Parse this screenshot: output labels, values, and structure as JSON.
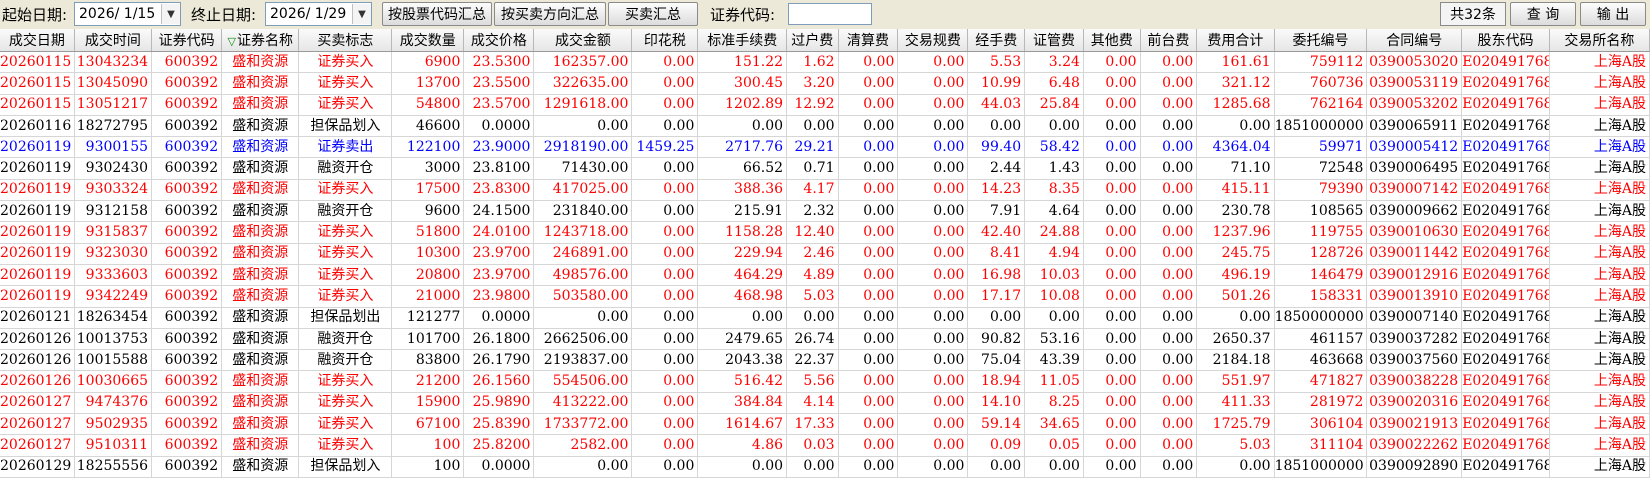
{
  "toolbar": {
    "start_label": "起始日期:",
    "start_date": "2026/ 1/15",
    "end_label": "终止日期:",
    "end_date": "2026/ 1/29",
    "btn_by_code": "按股票代码汇总",
    "btn_by_direction": "按买卖方向汇总",
    "btn_summary": "买卖汇总",
    "code_label": "证券代码:",
    "code_value": "",
    "count": "共32条",
    "query": "查 询",
    "export": "输 出"
  },
  "icons": {
    "date_dropdown": "chevron-down-icon",
    "sort": "sort-down-triangle-icon"
  },
  "colors": {
    "buy": "#ff0000",
    "sell": "#0000ff",
    "other": "#000000"
  },
  "table": {
    "headers": [
      "成交日期",
      "成交时间",
      "证券代码",
      "证券名称",
      "买卖标志",
      "成交数量",
      "成交价格",
      "成交金额",
      "印花税",
      "标准手续费",
      "过户费",
      "清算费",
      "交易规费",
      "经手费",
      "证管费",
      "其他费",
      "前台费",
      "费用合计",
      "委托编号",
      "合同编号",
      "股东代码",
      "交易所名称"
    ],
    "rows": [
      {
        "type": "buy",
        "cells": [
          "20260115",
          "13043234",
          "600392",
          "盛和资源",
          "证券买入",
          "6900",
          "23.5300",
          "162357.00",
          "0.00",
          "151.22",
          "1.62",
          "0.00",
          "0.00",
          "5.53",
          "3.24",
          "0.00",
          "0.00",
          "161.61",
          "759112",
          "0390053020",
          "E020491768",
          "上海A股"
        ]
      },
      {
        "type": "buy",
        "cells": [
          "20260115",
          "13045090",
          "600392",
          "盛和资源",
          "证券买入",
          "13700",
          "23.5500",
          "322635.00",
          "0.00",
          "300.45",
          "3.20",
          "0.00",
          "0.00",
          "10.99",
          "6.48",
          "0.00",
          "0.00",
          "321.12",
          "760736",
          "0390053119",
          "E020491768",
          "上海A股"
        ]
      },
      {
        "type": "buy",
        "cells": [
          "20260115",
          "13051217",
          "600392",
          "盛和资源",
          "证券买入",
          "54800",
          "23.5700",
          "1291618.00",
          "0.00",
          "1202.89",
          "12.92",
          "0.00",
          "0.00",
          "44.03",
          "25.84",
          "0.00",
          "0.00",
          "1285.68",
          "762164",
          "0390053202",
          "E020491768",
          "上海A股"
        ]
      },
      {
        "type": "other",
        "cells": [
          "20260116",
          "18272795",
          "600392",
          "盛和资源",
          "担保品划入",
          "46600",
          "0.0000",
          "0.00",
          "0.00",
          "0.00",
          "0.00",
          "0.00",
          "0.00",
          "0.00",
          "0.00",
          "0.00",
          "0.00",
          "0.00",
          "1851000000",
          "0390065911",
          "E020491768",
          "上海A股"
        ]
      },
      {
        "type": "sell",
        "cells": [
          "20260119",
          "9300155",
          "600392",
          "盛和资源",
          "证券卖出",
          "122100",
          "23.9000",
          "2918190.00",
          "1459.25",
          "2717.76",
          "29.21",
          "0.00",
          "0.00",
          "99.40",
          "58.42",
          "0.00",
          "0.00",
          "4364.04",
          "59971",
          "0390005412",
          "E020491768",
          "上海A股"
        ]
      },
      {
        "type": "other",
        "cells": [
          "20260119",
          "9302430",
          "600392",
          "盛和资源",
          "融资开仓",
          "3000",
          "23.8100",
          "71430.00",
          "0.00",
          "66.52",
          "0.71",
          "0.00",
          "0.00",
          "2.44",
          "1.43",
          "0.00",
          "0.00",
          "71.10",
          "72548",
          "0390006495",
          "E020491768",
          "上海A股"
        ]
      },
      {
        "type": "buy",
        "cells": [
          "20260119",
          "9303324",
          "600392",
          "盛和资源",
          "证券买入",
          "17500",
          "23.8300",
          "417025.00",
          "0.00",
          "388.36",
          "4.17",
          "0.00",
          "0.00",
          "14.23",
          "8.35",
          "0.00",
          "0.00",
          "415.11",
          "79390",
          "0390007142",
          "E020491768",
          "上海A股"
        ]
      },
      {
        "type": "other",
        "cells": [
          "20260119",
          "9312158",
          "600392",
          "盛和资源",
          "融资开仓",
          "9600",
          "24.1500",
          "231840.00",
          "0.00",
          "215.91",
          "2.32",
          "0.00",
          "0.00",
          "7.91",
          "4.64",
          "0.00",
          "0.00",
          "230.78",
          "108565",
          "0390009662",
          "E020491768",
          "上海A股"
        ]
      },
      {
        "type": "buy",
        "cells": [
          "20260119",
          "9315837",
          "600392",
          "盛和资源",
          "证券买入",
          "51800",
          "24.0100",
          "1243718.00",
          "0.00",
          "1158.28",
          "12.40",
          "0.00",
          "0.00",
          "42.40",
          "24.88",
          "0.00",
          "0.00",
          "1237.96",
          "119755",
          "0390010630",
          "E020491768",
          "上海A股"
        ]
      },
      {
        "type": "buy",
        "cells": [
          "20260119",
          "9323030",
          "600392",
          "盛和资源",
          "证券买入",
          "10300",
          "23.9700",
          "246891.00",
          "0.00",
          "229.94",
          "2.46",
          "0.00",
          "0.00",
          "8.41",
          "4.94",
          "0.00",
          "0.00",
          "245.75",
          "128726",
          "0390011442",
          "E020491768",
          "上海A股"
        ]
      },
      {
        "type": "buy",
        "cells": [
          "20260119",
          "9333603",
          "600392",
          "盛和资源",
          "证券买入",
          "20800",
          "23.9700",
          "498576.00",
          "0.00",
          "464.29",
          "4.89",
          "0.00",
          "0.00",
          "16.98",
          "10.03",
          "0.00",
          "0.00",
          "496.19",
          "146479",
          "0390012916",
          "E020491768",
          "上海A股"
        ]
      },
      {
        "type": "buy",
        "cells": [
          "20260119",
          "9342249",
          "600392",
          "盛和资源",
          "证券买入",
          "21000",
          "23.9800",
          "503580.00",
          "0.00",
          "468.98",
          "5.03",
          "0.00",
          "0.00",
          "17.17",
          "10.08",
          "0.00",
          "0.00",
          "501.26",
          "158331",
          "0390013910",
          "E020491768",
          "上海A股"
        ]
      },
      {
        "type": "other",
        "cells": [
          "20260121",
          "18263454",
          "600392",
          "盛和资源",
          "担保品划出",
          "121277",
          "0.0000",
          "0.00",
          "0.00",
          "0.00",
          "0.00",
          "0.00",
          "0.00",
          "0.00",
          "0.00",
          "0.00",
          "0.00",
          "0.00",
          "1850000000",
          "0390007140",
          "E020491768",
          "上海A股"
        ]
      },
      {
        "type": "other",
        "cells": [
          "20260126",
          "10013753",
          "600392",
          "盛和资源",
          "融资开仓",
          "101700",
          "26.1800",
          "2662506.00",
          "0.00",
          "2479.65",
          "26.74",
          "0.00",
          "0.00",
          "90.82",
          "53.16",
          "0.00",
          "0.00",
          "2650.37",
          "461157",
          "0390037282",
          "E020491768",
          "上海A股"
        ]
      },
      {
        "type": "other",
        "cells": [
          "20260126",
          "10015588",
          "600392",
          "盛和资源",
          "融资开仓",
          "83800",
          "26.1790",
          "2193837.00",
          "0.00",
          "2043.38",
          "22.37",
          "0.00",
          "0.00",
          "75.04",
          "43.39",
          "0.00",
          "0.00",
          "2184.18",
          "463668",
          "0390037560",
          "E020491768",
          "上海A股"
        ]
      },
      {
        "type": "buy",
        "cells": [
          "20260126",
          "10030665",
          "600392",
          "盛和资源",
          "证券买入",
          "21200",
          "26.1560",
          "554506.00",
          "0.00",
          "516.42",
          "5.56",
          "0.00",
          "0.00",
          "18.94",
          "11.05",
          "0.00",
          "0.00",
          "551.97",
          "471827",
          "0390038228",
          "E020491768",
          "上海A股"
        ]
      },
      {
        "type": "buy",
        "cells": [
          "20260127",
          "9474376",
          "600392",
          "盛和资源",
          "证券买入",
          "15900",
          "25.9890",
          "413222.00",
          "0.00",
          "384.84",
          "4.14",
          "0.00",
          "0.00",
          "14.10",
          "8.25",
          "0.00",
          "0.00",
          "411.33",
          "281972",
          "0390020316",
          "E020491768",
          "上海A股"
        ]
      },
      {
        "type": "buy",
        "cells": [
          "20260127",
          "9502935",
          "600392",
          "盛和资源",
          "证券买入",
          "67100",
          "25.8390",
          "1733772.00",
          "0.00",
          "1614.67",
          "17.33",
          "0.00",
          "0.00",
          "59.14",
          "34.65",
          "0.00",
          "0.00",
          "1725.79",
          "306104",
          "0390021913",
          "E020491768",
          "上海A股"
        ]
      },
      {
        "type": "buy",
        "cells": [
          "20260127",
          "9510311",
          "600392",
          "盛和资源",
          "证券买入",
          "100",
          "25.8200",
          "2582.00",
          "0.00",
          "4.86",
          "0.03",
          "0.00",
          "0.00",
          "0.09",
          "0.05",
          "0.00",
          "0.00",
          "5.03",
          "311104",
          "0390022262",
          "E020491768",
          "上海A股"
        ]
      },
      {
        "type": "other",
        "cells": [
          "20260129",
          "18255556",
          "600392",
          "盛和资源",
          "担保品划入",
          "100",
          "0.0000",
          "0.00",
          "0.00",
          "0.00",
          "0.00",
          "0.00",
          "0.00",
          "0.00",
          "0.00",
          "0.00",
          "0.00",
          "0.00",
          "1851000000",
          "0390092890",
          "E020491768",
          "上海A股"
        ]
      }
    ]
  }
}
